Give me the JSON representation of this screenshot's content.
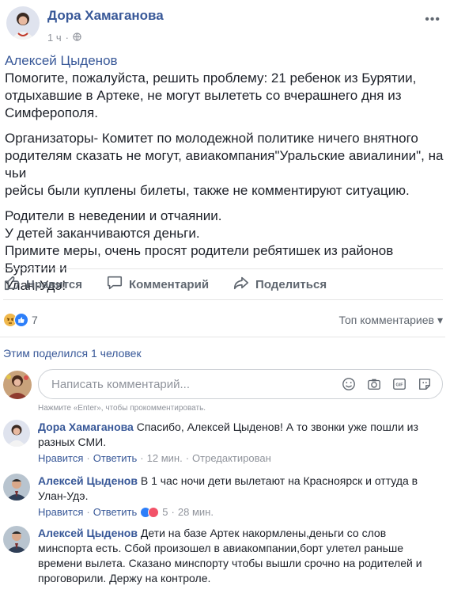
{
  "post": {
    "author": "Дора Хамаганова",
    "time": "1 ч",
    "dot": "·",
    "quoted_author": "Алексей Цыденов",
    "paragraphs": [
      [
        "Помогите, пожалуйста, решить проблему: 21 ребенок из Бурятии,",
        "отдыхавшие в Артеке, не могут вылететь со вчерашнего дня из",
        "Симферополя."
      ],
      [
        "Организаторы- Комитет по молодежной политике ничего внятного",
        "родителям сказать не могут, авиакомпания\"Уральские авиалинии\", на чьи",
        "рейсы были куплены билеты, также не комментируют ситуацию."
      ],
      [
        "Родители в неведении и отчаянии.",
        "У детей заканчиваются деньги.",
        "Примите меры, очень просят родители ребятишек из районов Бурятии и",
        "Улан-Удэ!"
      ]
    ]
  },
  "actions": {
    "like": "Нравится",
    "comment": "Комментарий",
    "share": "Поделиться"
  },
  "reactions": {
    "count": "7",
    "sort_label": "Топ комментариев",
    "sort_arrow": "▾"
  },
  "shared_by": "Этим поделился 1 человек",
  "compose": {
    "placeholder": "Написать комментарий...",
    "hint": "Нажмите «Enter», чтобы прокомментировать.",
    "gif": "GIF"
  },
  "comments": [
    {
      "author": "Дора Хамаганова",
      "lines": [
        "Спасибо, Алексей Цыденов! А то звонки уже пошли из",
        "разных СМИ."
      ],
      "like": "Нравится",
      "reply": "Ответить",
      "time": "12 мин.",
      "edited": "Отредактирован"
    },
    {
      "author": "Алексей Цыденов",
      "lines": [
        "В 1 час ночи дети вылетают на Красноярск и оттуда в",
        "Улан-Удэ."
      ],
      "like": "Нравится",
      "reply": "Ответить",
      "reactions_count": "5",
      "time": "28 мин."
    },
    {
      "author": "Алексей Цыденов",
      "lines": [
        "Дети на базе Артек накормлены,деньги со слов",
        "минспорта есть. Сбой произошел в авиакомпании,борт улетел раньше",
        "времени вылета. Сказано минспорту чтобы вышли срочно на родителей и",
        "проговорили. Держу на контроле."
      ]
    }
  ],
  "sep": "·",
  "colors": {
    "link": "#385898",
    "text": "#1d2129",
    "muted": "#90949c",
    "like_blue": "#2d7ff9",
    "angry": "#f0b84c"
  }
}
